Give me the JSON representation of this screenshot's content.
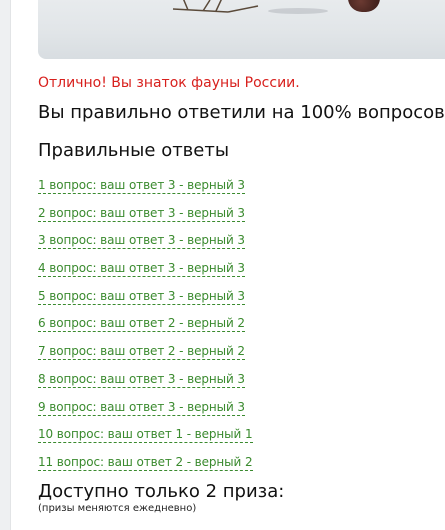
{
  "quiz_result": {
    "praise": "Отлично! Вы знаток фауны России.",
    "score": "Вы правильно ответили на 100% вопросов",
    "answers_heading": "Правильные ответы",
    "answers": [
      "1 вопрос: ваш ответ 3 - верный 3",
      "2 вопрос: ваш ответ 3 - верный 3",
      "3 вопрос: ваш ответ 3 - верный 3",
      "4 вопрос: ваш ответ 3 - верный 3",
      "5 вопрос: ваш ответ 3 - верный 3",
      "6 вопрос: ваш ответ 2 - верный 2",
      "7 вопрос: ваш ответ 2 - верный 2",
      "8 вопрос: ваш ответ 3 - верный 3",
      "9 вопрос: ваш ответ 3 - верный 3",
      "10 вопрос: ваш ответ 1 - верный 1",
      "11 вопрос: ваш ответ 2 - верный 2"
    ]
  },
  "prizes": {
    "heading": "Доступно только 2 приза:",
    "note": "(призы меняются ежедневно)"
  },
  "colors": {
    "praise": "#d8201d",
    "answer_link": "#3a8a2e",
    "text": "#111111"
  }
}
